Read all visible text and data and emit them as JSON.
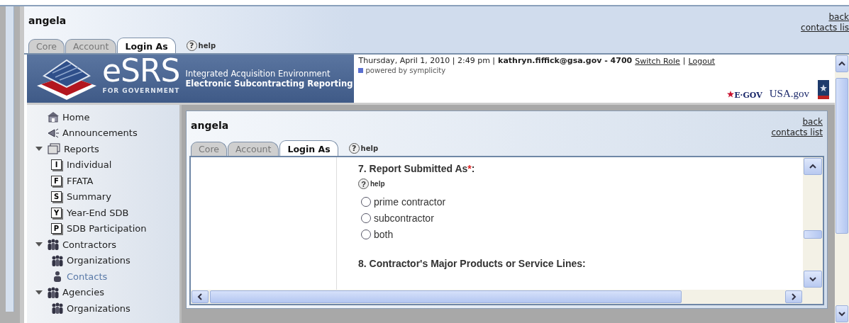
{
  "header": {
    "title": "angela",
    "tabs": [
      {
        "label": "Core",
        "selected": false
      },
      {
        "label": "Account",
        "selected": false
      },
      {
        "label": "Login As",
        "selected": true
      }
    ],
    "help": {
      "mark": "?",
      "label": "help"
    },
    "links": [
      "back",
      "contacts lis"
    ]
  },
  "banner": {
    "brand": "eSRS",
    "brand_sub": "FOR GOVERNMENT",
    "line1": "Integrated Acquisition Environment",
    "line2": "Electronic Subcontracting Reporting",
    "info": {
      "datetime": "Thursday, April 1, 2010 | 2:49 pm |",
      "user": "kathryn.fiffick@gsa.gov - 4700",
      "links": [
        "Switch Role",
        "Logout"
      ],
      "separator": "|",
      "powered": "powered by symplicity",
      "logos": [
        {
          "kind": "egov",
          "text": "E·GOV"
        },
        {
          "kind": "usagov",
          "text": "USA.gov"
        },
        {
          "kind": "seal"
        }
      ]
    }
  },
  "sidebar": {
    "items": [
      {
        "label": "Home",
        "kind": "home",
        "selected": false
      },
      {
        "label": "Announcements",
        "kind": "megaphone",
        "selected": false
      },
      {
        "label": "Reports",
        "kind": "folder",
        "selected": false,
        "expanded": true,
        "children": [
          {
            "label": "Individual",
            "kind": "badge",
            "badge": "I",
            "selected": false
          },
          {
            "label": "FFATA",
            "kind": "badge",
            "badge": "F",
            "selected": false
          },
          {
            "label": "Summary",
            "kind": "badge",
            "badge": "S",
            "selected": false
          },
          {
            "label": "Year-End SDB",
            "kind": "badge",
            "badge": "Y",
            "selected": false
          },
          {
            "label": "SDB Participation",
            "kind": "badge",
            "badge": "P",
            "selected": false
          }
        ]
      },
      {
        "label": "Contractors",
        "kind": "people",
        "selected": false,
        "expanded": true,
        "children": [
          {
            "label": "Organizations",
            "kind": "people",
            "selected": false
          },
          {
            "label": "Contacts",
            "kind": "person",
            "selected": true
          }
        ]
      },
      {
        "label": "Agencies",
        "kind": "people",
        "selected": false,
        "expanded": true,
        "children": [
          {
            "label": "Organizations",
            "kind": "people",
            "selected": false
          }
        ]
      }
    ]
  },
  "panel": {
    "title": "angela",
    "tabs": [
      {
        "label": "Core",
        "selected": false
      },
      {
        "label": "Account",
        "selected": false
      },
      {
        "label": "Login As",
        "selected": true
      }
    ],
    "help": {
      "mark": "?",
      "label": "help"
    },
    "links": [
      "back",
      "contacts list"
    ],
    "question": {
      "label": "7. Report Submitted As",
      "required_mark": "*",
      "label_end": ":",
      "help": {
        "mark": "?",
        "label": "help"
      },
      "options": [
        {
          "label": "prime contractor",
          "selected": false
        },
        {
          "label": "subcontractor",
          "selected": false
        },
        {
          "label": "both",
          "selected": false
        }
      ]
    },
    "next_question": "8. Contractor's Major Products or Service Lines:"
  }
}
